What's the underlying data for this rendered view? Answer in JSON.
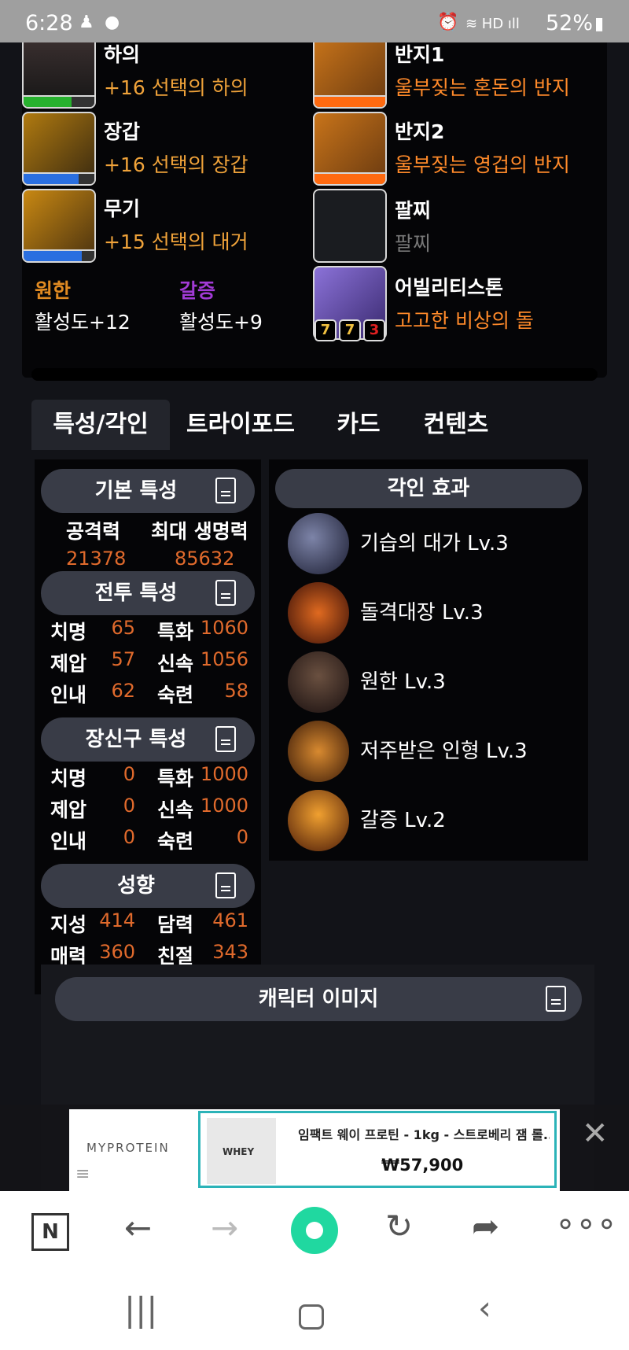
{
  "status": {
    "time": "6:28",
    "battery": "52%"
  },
  "equipment": {
    "left": [
      {
        "name": "하의",
        "value": "+16 선택의 하의",
        "bar_color": "#27b12e"
      },
      {
        "name": "장갑",
        "value": "+16 선택의 장갑",
        "bar_color": "#2a6fe0"
      },
      {
        "name": "무기",
        "value": "+15 선택의 대거",
        "bar_color": "#2a6fe0"
      }
    ],
    "right": [
      {
        "name": "반지1",
        "value": "울부짖는 혼돈의 반지"
      },
      {
        "name": "반지2",
        "value": "울부짖는 영겁의 반지"
      },
      {
        "name": "팔찌",
        "value": "팔찌"
      },
      {
        "name": "어빌리티스톤",
        "value": "고고한 비상의 돌",
        "levels": [
          "7",
          "7",
          "3"
        ]
      }
    ],
    "sets": [
      {
        "name": "원한",
        "value": "활성도+12",
        "color": "#e08a22"
      },
      {
        "name": "갈증",
        "value": "활성도+9",
        "color": "#a23bd6"
      }
    ]
  },
  "tabs": [
    "특성/각인",
    "트라이포드",
    "카드",
    "컨텐츠"
  ],
  "stats": {
    "basic_title": "기본 특성",
    "attack_label": "공격력",
    "attack_value": "21378",
    "hp_label": "최대 생명력",
    "hp_value": "85632",
    "combat_title": "전투 특성",
    "combat": [
      {
        "l1": "치명",
        "v1": "65",
        "l2": "특화",
        "v2": "1060"
      },
      {
        "l1": "제압",
        "v1": "57",
        "l2": "신속",
        "v2": "1056"
      },
      {
        "l1": "인내",
        "v1": "62",
        "l2": "숙련",
        "v2": "58"
      }
    ],
    "acc_title": "장신구 특성",
    "acc": [
      {
        "l1": "치명",
        "v1": "0",
        "l2": "특화",
        "v2": "1000"
      },
      {
        "l1": "제압",
        "v1": "0",
        "l2": "신속",
        "v2": "1000"
      },
      {
        "l1": "인내",
        "v1": "0",
        "l2": "숙련",
        "v2": "0"
      }
    ],
    "tend_title": "성향",
    "tend": [
      {
        "l1": "지성",
        "v1": "414",
        "l2": "담력",
        "v2": "461"
      },
      {
        "l1": "매력",
        "v1": "360",
        "l2": "친절",
        "v2": "343"
      }
    ]
  },
  "engraving": {
    "title": "각인 효과",
    "items": [
      "기습의 대가 Lv.3",
      "돌격대장 Lv.3",
      "원한 Lv.3",
      "저주받은 인형 Lv.3",
      "갈증 Lv.2"
    ]
  },
  "char_image_title": "캐릭터 이미지",
  "ad": {
    "brand": "MYPROTEIN",
    "product": "임팩트 웨이 프로틴 - 1kg - 스트로베리 잼 롤...",
    "price": "₩57,900",
    "label": "WHEY"
  }
}
